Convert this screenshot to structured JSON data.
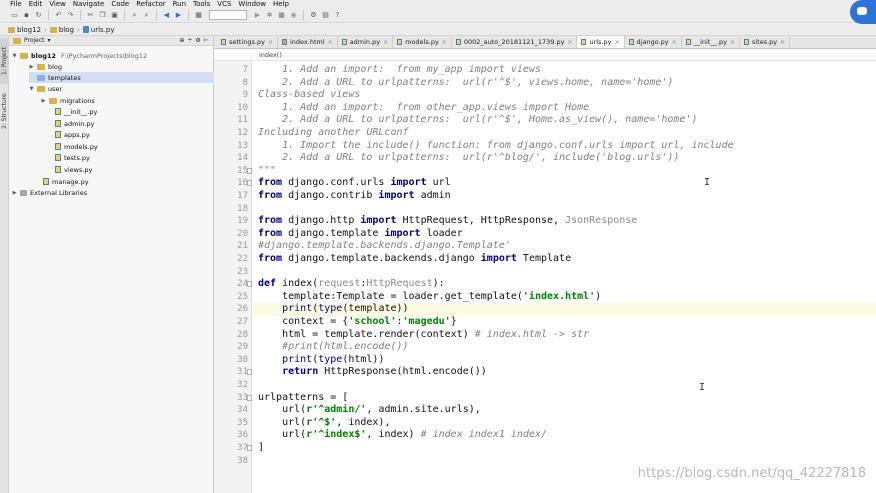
{
  "menu": [
    "File",
    "Edit",
    "View",
    "Navigate",
    "Code",
    "Refactor",
    "Run",
    "Tools",
    "VCS",
    "Window",
    "Help"
  ],
  "breadcrumb": [
    "blog12",
    "blog",
    "urls.py"
  ],
  "sidebar_tabs": [
    "1: Project",
    "2: Structure"
  ],
  "project": {
    "header": "Project",
    "root": "blog12",
    "root_path": "F:\\PycharmProjects\\blog12",
    "tree": [
      {
        "label": "blog",
        "type": "folder"
      },
      {
        "label": "templates",
        "type": "folder-blue",
        "selected": true
      },
      {
        "label": "user",
        "type": "folder"
      },
      {
        "label": "migrations",
        "type": "folder"
      },
      {
        "label": "__init__.py",
        "type": "py"
      },
      {
        "label": "admin.py",
        "type": "py"
      },
      {
        "label": "apps.py",
        "type": "py"
      },
      {
        "label": "models.py",
        "type": "py"
      },
      {
        "label": "tests.py",
        "type": "py"
      },
      {
        "label": "views.py",
        "type": "py"
      },
      {
        "label": "manage.py",
        "type": "py"
      },
      {
        "label": "External Libraries",
        "type": "lib"
      }
    ]
  },
  "tabs": [
    {
      "label": "settings.py",
      "active": false
    },
    {
      "label": "index.html",
      "active": false
    },
    {
      "label": "admin.py",
      "active": false
    },
    {
      "label": "models.py",
      "active": false
    },
    {
      "label": "0002_auto_20181121_1739.py",
      "active": false
    },
    {
      "label": "urls.py",
      "active": true
    },
    {
      "label": "django.py",
      "active": false
    },
    {
      "label": "__init__.py",
      "active": false
    },
    {
      "label": "sites.py",
      "active": false
    }
  ],
  "editor_breadcrumb": "index()",
  "code": {
    "first_line": 7,
    "current_line": 26,
    "lines": [
      "    1. Add an import:  from my_app import views",
      "    2. Add a URL to urlpatterns:  url(r'^$', views.home, name='home')",
      "Class-based views",
      "    1. Add an import:  from other_app.views import Home",
      "    2. Add a URL to urlpatterns:  url(r'^$', Home.as_view(), name='home')",
      "Including another URLconf",
      "    1. Import the include() function: from django.conf.urls import url, include",
      "    2. Add a URL to urlpatterns:  url(r'^blog/', include('blog.urls'))",
      "\"\"\"",
      "from django.conf.urls import url",
      "from django.contrib import admin",
      "",
      "from django.http import HttpRequest, HttpResponse, JsonResponse",
      "from django.template import loader",
      "#django.template.backends.django.Template'",
      "from django.template.backends.django import Template",
      "",
      "def index(request:HttpRequest):",
      "    template:Template = loader.get_template('index.html')",
      "    print(type(template))",
      "    context = {'school':'magedu'}",
      "    html = template.render(context) # index.html -> str",
      "    #print(html.encode())",
      "    print(type(html))",
      "    return HttpResponse(html.encode())",
      "",
      "urlpatterns = [",
      "    url(r'^admin/', admin.site.urls),",
      "    url(r'^$', index),",
      "    url(r'^index$', index) # index index1 index/",
      "]",
      ""
    ]
  },
  "watermark": "https://blog.csdn.net/qq_42227818"
}
